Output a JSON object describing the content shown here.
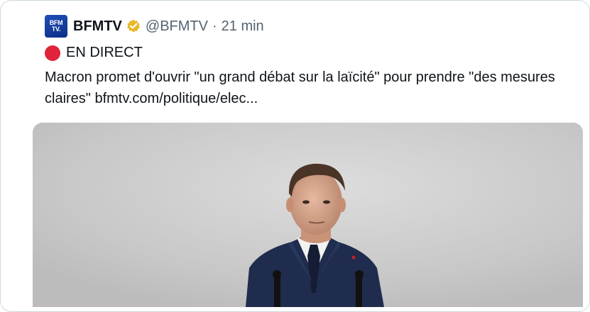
{
  "tweet": {
    "avatar_text_line1": "BFM",
    "avatar_text_line2": "TV.",
    "author_name": "BFMTV",
    "handle": "@BFMTV",
    "separator": "·",
    "time": "21 min",
    "live_label": "EN DIRECT",
    "text_main": "Macron promet d'ouvrir \"un grand débat sur la laïcité\" pour prendre \"des mesures claires\" ",
    "link_text": "bfmtv.com/politique/elec..."
  },
  "colors": {
    "border": "#cfd9de",
    "avatar_bg": "#1f4fb8",
    "verified_badge": "#e8b829",
    "live_dot": "#e0233a",
    "secondary_text": "#536471",
    "primary_text": "#0f1419"
  },
  "icons": {
    "verified": "verified-badge-icon",
    "live": "live-dot-icon"
  }
}
